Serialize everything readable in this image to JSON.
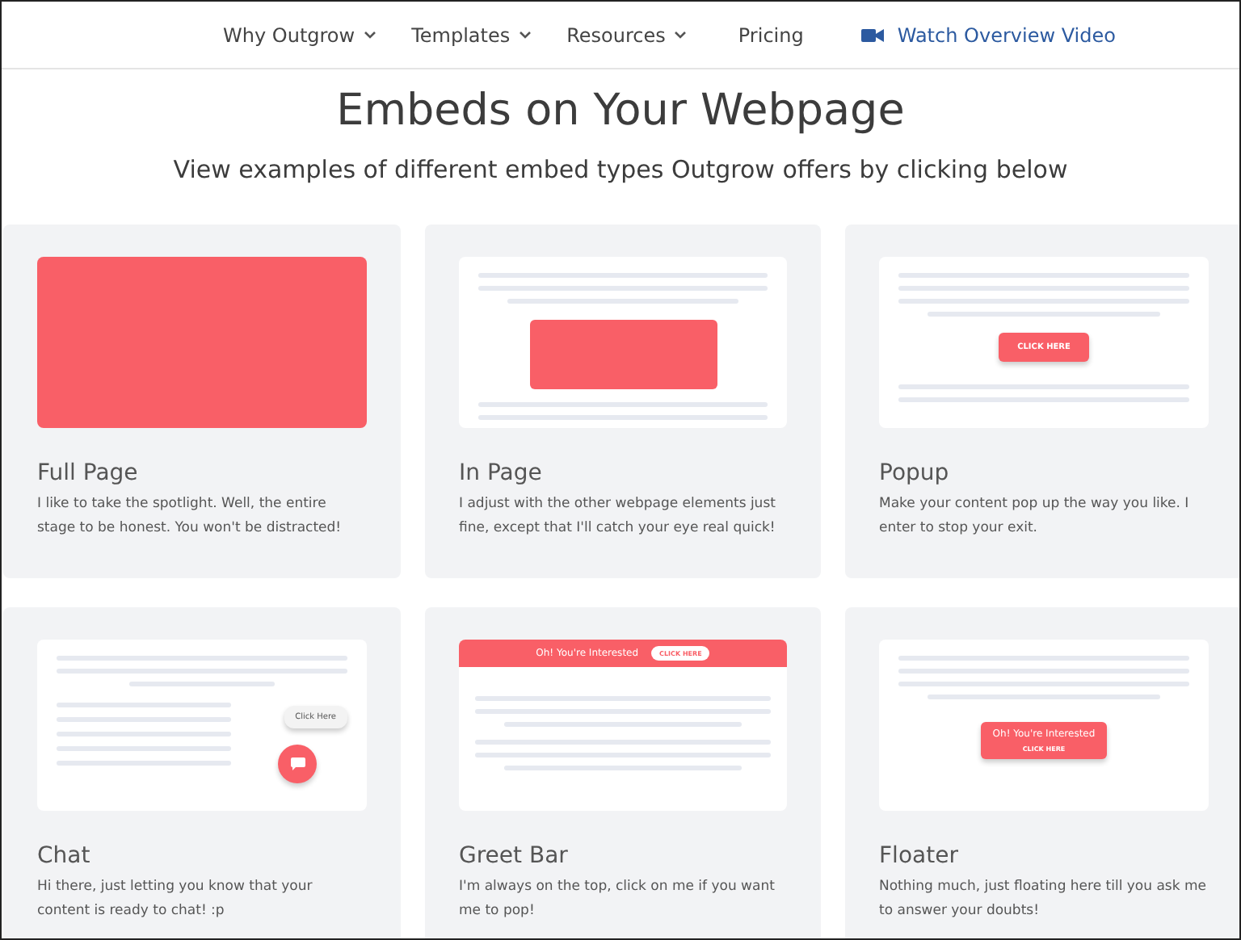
{
  "nav": [
    {
      "label": "Why Outgrow",
      "kind": "dropdown"
    },
    {
      "label": "Templates",
      "kind": "dropdown"
    },
    {
      "label": "Resources",
      "kind": "dropdown"
    },
    {
      "label": "Pricing",
      "kind": "link"
    },
    {
      "label": "Watch Overview Video",
      "kind": "video"
    }
  ],
  "heading": "Embeds on Your Webpage",
  "subheading": "View examples of different embed types Outgrow offers by clicking below",
  "cards": [
    {
      "title": "Full Page",
      "description": "I like to take the spotlight. Well, the entire stage to be honest. You won't be distracted!",
      "preview": {
        "kind": "full"
      }
    },
    {
      "title": "In Page",
      "description": "I adjust with the other webpage elements just fine, except that I'll catch your eye real quick!",
      "preview": {
        "kind": "inpage"
      }
    },
    {
      "title": "Popup",
      "description": "Make your content pop up the way you like. I enter to stop your exit.",
      "preview": {
        "kind": "popup",
        "button": "CLICK HERE"
      }
    },
    {
      "title": "Chat",
      "description": "Hi there, just letting you know that your content is ready to chat! :p",
      "preview": {
        "kind": "chat",
        "button": "Click Here"
      }
    },
    {
      "title": "Greet Bar",
      "description": "I'm always on the top, click on me if you want me to pop!",
      "preview": {
        "kind": "greetbar",
        "message": "Oh! You're Interested",
        "button": "CLICK HERE"
      }
    },
    {
      "title": "Floater",
      "description": "Nothing much, just floating here till you ask me to answer your doubts!",
      "preview": {
        "kind": "floater",
        "message": "Oh! You're Interested",
        "button": "CLICK HERE"
      }
    }
  ]
}
